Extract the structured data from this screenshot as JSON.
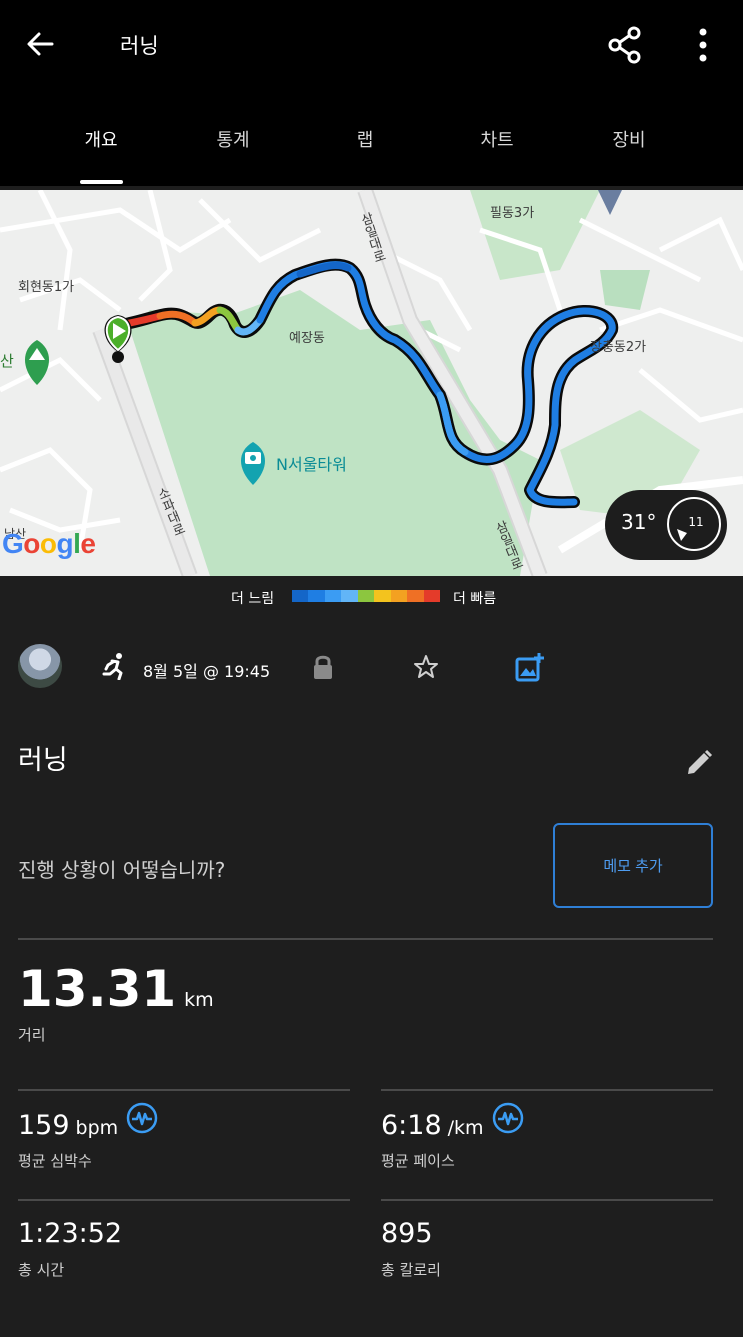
{
  "header": {
    "title": "러닝",
    "back_icon": "arrow-left-icon",
    "share_icon": "share-icon",
    "more_icon": "more-vert-icon"
  },
  "tabs": [
    {
      "label": "개요",
      "active": true
    },
    {
      "label": "통계",
      "active": false
    },
    {
      "label": "랩",
      "active": false
    },
    {
      "label": "차트",
      "active": false
    },
    {
      "label": "장비",
      "active": false
    }
  ],
  "map": {
    "labels": {
      "hoehyeon": "회현동1가",
      "pildong": "필동3가",
      "samil": "삼일대로",
      "yejang": "예장동",
      "jangchung": "장충동2가",
      "tower": "N서울타워",
      "sopa": "소파대로",
      "samil2": "삼일대로",
      "san": "산",
      "namsan": "남산"
    },
    "weather": {
      "temp": "31°",
      "wind": "11"
    }
  },
  "legend": {
    "slow": "더 느림",
    "fast": "더 빠름",
    "colors": [
      "#1466c8",
      "#1f7ee3",
      "#3b9cf3",
      "#62b5f7",
      "#8cc63f",
      "#f3c31e",
      "#f3a121",
      "#ef7025",
      "#e43b2a"
    ]
  },
  "meta": {
    "date": "8월 5일 @ 19:45"
  },
  "activity": {
    "title": "러닝",
    "prompt": "진행 상황이 어떻습니까?",
    "memo_button": "메모 추가"
  },
  "stats": {
    "distance": {
      "value": "13.31",
      "unit": "km",
      "label": "거리"
    },
    "heart_rate": {
      "value": "159",
      "unit": "bpm",
      "label": "평균 심박수"
    },
    "pace": {
      "value": "6:18",
      "unit": "/km",
      "label": "평균 페이스"
    },
    "time": {
      "value": "1:23:52",
      "label": "총 시간"
    },
    "calories": {
      "value": "895",
      "label": "총 칼로리"
    }
  },
  "colors": {
    "accent": "#2f7fd6",
    "background": "#1e1e1e",
    "topbar": "#000000"
  }
}
